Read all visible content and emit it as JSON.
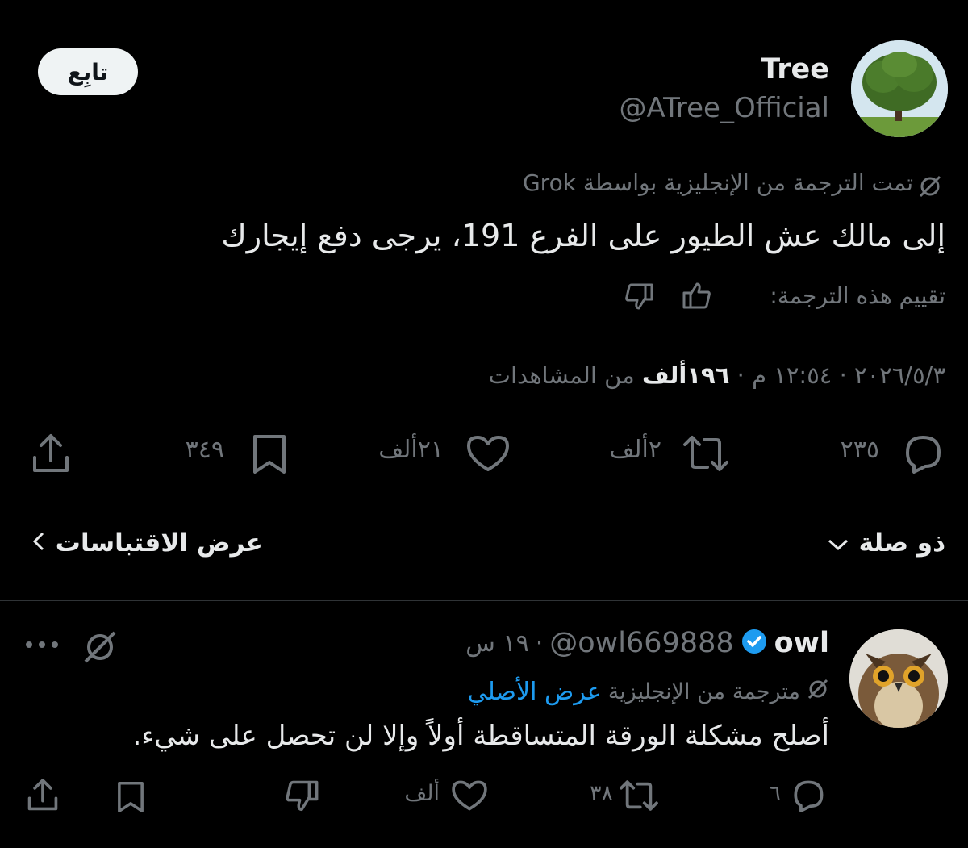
{
  "tweet": {
    "author_name": "Tree",
    "author_handle": "@ATree_Official",
    "follow_label": "تابِع",
    "translation_note": "تمت الترجمة من الإنجليزية بواسطة Grok",
    "text": "إلى مالك عش الطيور على الفرع 191، يرجى دفع إيجارك",
    "rate_translation": "تقييم هذه الترجمة:",
    "date": "٢٠٢٦/٥/٣",
    "time": "١٢:٥٤ م",
    "views_value": "١٩٦ألف",
    "views_label": "من المشاهدات",
    "separator": "·",
    "replies": "٢٣٥",
    "retweets": "٢ألف",
    "likes": "٢١ألف",
    "bookmarks": "٣٤٩"
  },
  "filters": {
    "relevance_label": "ذو صلة",
    "quotes_label": "عرض الاقتباسات"
  },
  "reply": {
    "author_name": "owl",
    "author_handle": "@owl669888",
    "time": "١٩ س",
    "separator": "·",
    "translation_note": "مترجمة من الإنجليزية",
    "show_original": "عرض الأصلي",
    "text": "أصلح مشكلة الورقة المتساقطة أولاً وإلا لن تحصل على شيء.",
    "replies": "٦",
    "retweets": "٣٨",
    "likes": "ألف"
  },
  "colors": {
    "background": "#000000",
    "text": "#e7e9ea",
    "muted": "#71767b",
    "accent": "#1d9bf0",
    "divider": "#2f3336"
  },
  "icons": [
    "reply-icon",
    "retweet-icon",
    "like-icon",
    "bookmark-icon",
    "share-icon",
    "thumb-up-icon",
    "thumb-down-icon",
    "grok-icon",
    "more-icon",
    "verified-icon",
    "chevron-down-icon",
    "chevron-left-icon"
  ]
}
